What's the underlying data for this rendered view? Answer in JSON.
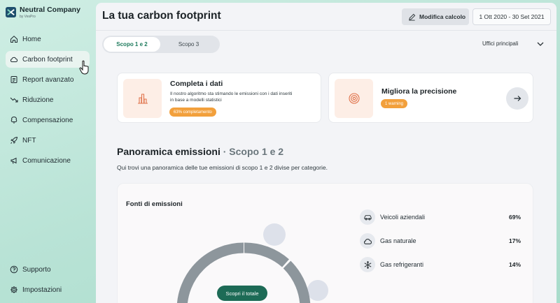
{
  "brand": {
    "name": "Neutral Company",
    "subtitle": "by VesPro"
  },
  "nav": {
    "items": [
      {
        "label": "Home",
        "icon": "home-icon"
      },
      {
        "label": "Carbon footprint",
        "icon": "cloud-icon",
        "active": true
      },
      {
        "label": "Report avanzato",
        "icon": "report-icon"
      },
      {
        "label": "Riduzione",
        "icon": "trend-down-icon"
      },
      {
        "label": "Compensazione",
        "icon": "tree-icon"
      },
      {
        "label": "NFT",
        "icon": "rocket-icon"
      },
      {
        "label": "Comunicazione",
        "icon": "megaphone-icon"
      }
    ],
    "bottom": [
      {
        "label": "Supporto",
        "icon": "help-icon"
      },
      {
        "label": "Impostazioni",
        "icon": "gear-icon"
      }
    ]
  },
  "header": {
    "title": "La tua carbon footprint",
    "edit_label": "Modifica calcolo",
    "date_range": "1 Ott 2020 - 30 Set 2021"
  },
  "tabs": [
    {
      "label": "Scopo 1 e 2",
      "active": true
    },
    {
      "label": "Scopo 3",
      "active": false
    }
  ],
  "office_select": {
    "value": "Uffici principali"
  },
  "cards": {
    "complete": {
      "title": "Completa i dati",
      "text": "Il nostro algoritmo sta stimando le emissioni con i dati inseriti in base a modelli statistici",
      "badge": "63% completamento",
      "progress_percent": 63
    },
    "precision": {
      "title": "Migliora la precisione",
      "badge": "1 warning"
    }
  },
  "overview": {
    "title": "Panoramica emissioni",
    "scope": "· Scopo 1 e 2",
    "subtitle": "Qui trovi una panoramica delle tue emissioni di scopo 1 e 2 divise per categorie."
  },
  "emissions": {
    "title": "Fonti di emissioni",
    "sources": [
      {
        "name": "Veicoli aziendali",
        "percent": "69%",
        "icon": "car-icon"
      },
      {
        "name": "Gas naturale",
        "percent": "17%",
        "icon": "cloud-icon"
      },
      {
        "name": "Gas refrigeranti",
        "percent": "14%",
        "icon": "snowflake-icon"
      }
    ],
    "discover_label": "Scopri il totale"
  },
  "colors": {
    "accent": "#1d6b56",
    "active_tab_text": "#1d7a5c",
    "badge": "#f2a03c",
    "icon_bg": "#fdeee6",
    "icon_stroke": "#e0724a",
    "donut": "#8d969c"
  }
}
